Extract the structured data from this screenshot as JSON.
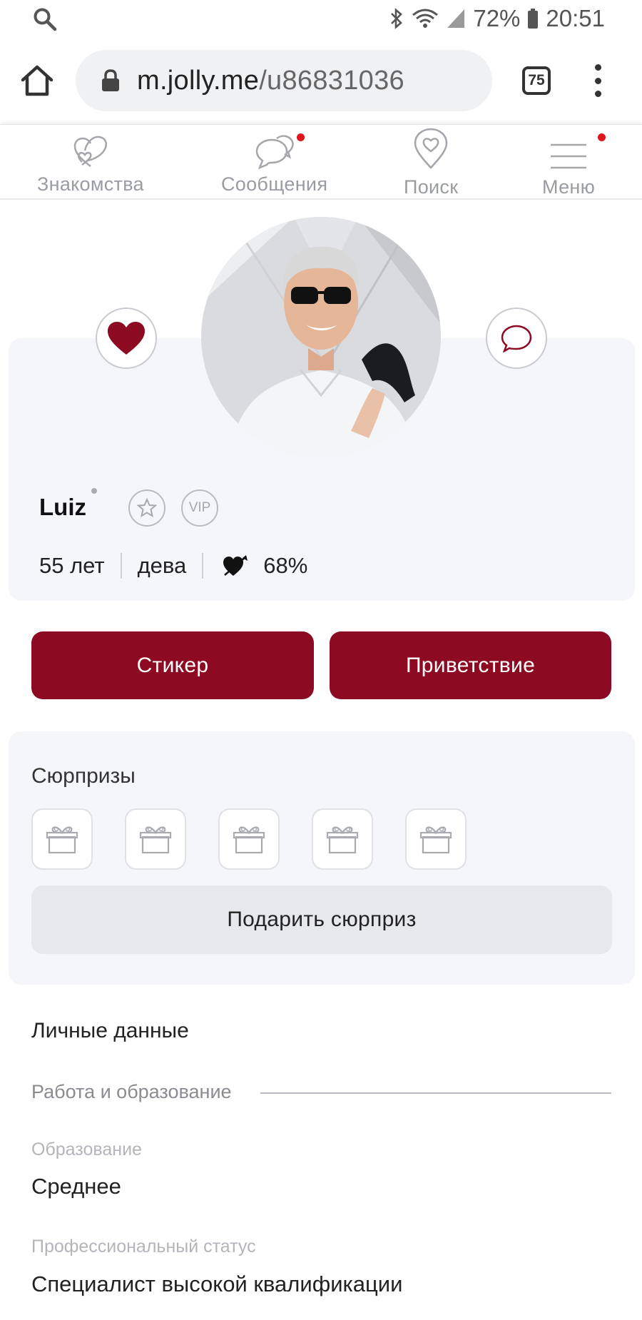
{
  "status_bar": {
    "battery": "72%",
    "time": "20:51",
    "icons": [
      "search-icon",
      "bluetooth-icon",
      "wifi-icon",
      "signal-icon",
      "battery-icon"
    ]
  },
  "browser": {
    "url_host": "m.jolly.me",
    "url_path": "/u86831036",
    "tab_count": "75"
  },
  "nav": {
    "items": [
      {
        "label": "Знакомства",
        "icon": "hearts-icon",
        "has_dot": false
      },
      {
        "label": "Сообщения",
        "icon": "chat-bubbles-icon",
        "has_dot": true
      },
      {
        "label": "Поиск",
        "icon": "location-heart-icon",
        "has_dot": false
      },
      {
        "label": "Меню",
        "icon": "hamburger-icon",
        "has_dot": true
      }
    ]
  },
  "profile": {
    "name": "Luiz",
    "vip_badge": "VIP",
    "age": "55 лет",
    "zodiac": "дева",
    "match": "68%"
  },
  "actions": {
    "sticker_label": "Стикер",
    "greeting_label": "Приветствие"
  },
  "surprises": {
    "title": "Сюрпризы",
    "slots": 5,
    "give_label": "Подарить сюрприз"
  },
  "personal": {
    "title": "Личные данные",
    "work_education_heading": "Работа и образование",
    "education_label": "Образование",
    "education_value": "Среднее",
    "status_label": "Профессиональный статус",
    "status_value": "Специалист высокой квалификации"
  },
  "colors": {
    "brand": "#8c0a22",
    "card_bg": "#f5f6f9",
    "notification_dot": "#e0141e"
  }
}
